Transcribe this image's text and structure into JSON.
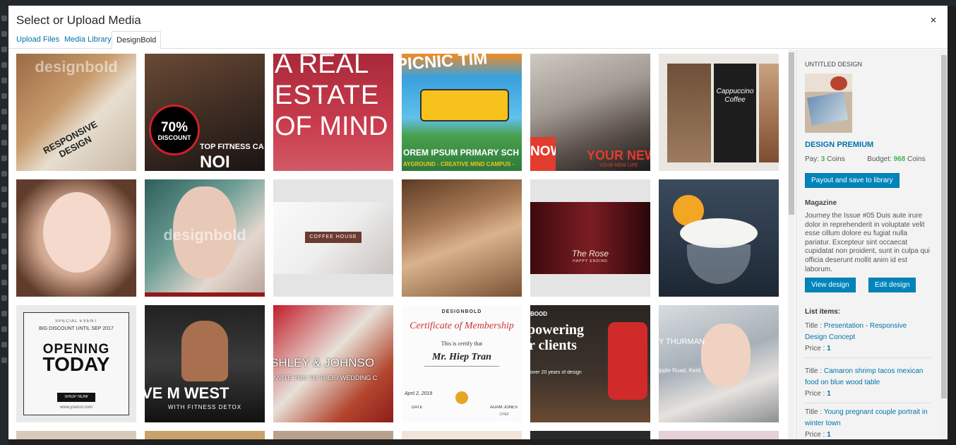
{
  "modal": {
    "title": "Select or Upload Media",
    "close_glyph": "×"
  },
  "tabs": [
    {
      "label": "Upload Files",
      "active": false
    },
    {
      "label": "Media Library",
      "active": false
    },
    {
      "label": "DesignBold",
      "active": true
    }
  ],
  "thumbnails": [
    {
      "caption": "RESPONSIVE DESIGN",
      "watermark": "designbold"
    },
    {
      "badge_value": "70%",
      "badge_label": "DISCOUNT",
      "caption": "TOP FITNESS CA",
      "caption2": "NOI"
    },
    {
      "line1": "A REAL",
      "line2": "ESTATE",
      "line3": "OF MIND"
    },
    {
      "top": "PICNIC TIM",
      "caption": "OREM IPSUM PRIMARY SCH",
      "caption2": "AYGROUND - CREATIVE MIND CAMPUS -"
    },
    {
      "badge": "NOW",
      "caption": "YOUR NEW",
      "caption2": "YOUR NEW LIFE"
    },
    {
      "caption": "Cappuccino Coffee"
    },
    {
      "caption": ""
    },
    {
      "watermark": "designbold"
    },
    {
      "caption": "COFFEE HOUSE"
    },
    {
      "caption": ""
    },
    {
      "caption": "The Rose",
      "caption2": "HAPPY ENDING"
    },
    {
      "caption": ""
    },
    {
      "small": "SPECIAL EVENT",
      "small2": "BIG DISCOUNT UNTIL SEP 2017",
      "line1": "OPENING",
      "line2": "TODAY",
      "button": "SHOP NOW",
      "url": "www.yoururl.com"
    },
    {
      "caption": "VE M WEST",
      "caption2": "WITH FITNESS DETOX"
    },
    {
      "caption": "SHLEY & JOHNSO",
      "caption2": "NVITE YOU TO THEIR WEDDING C"
    },
    {
      "brand": "DESIGNBOLD",
      "title": "Certificate of Membership",
      "line": "This is certify that",
      "name": "Mr. Hiep Tran",
      "date": "April 2, 2019",
      "date_label": "DATE",
      "signer": "ADAM JONES",
      "signer_role": "CHEF"
    },
    {
      "brand": "BOOD",
      "line1": "powering",
      "line2": "r clients",
      "body": "over 20 years of design"
    },
    {
      "caption": "Y THURMAN",
      "caption2": "ipple Road, Kent"
    }
  ],
  "sidebar": {
    "heading": "UNTITLED DESIGN",
    "premium_label": "DESIGN PREMIUM",
    "pay_label": "Pay:",
    "pay_value": "3",
    "pay_unit": "Coins",
    "budget_label": "Budget:",
    "budget_value": "968",
    "budget_unit": "Coins",
    "payout_button": "Payout and save to library",
    "category": "Magazine",
    "description": "Journey the Issue #05 Duis aute irure dolor in reprehenderit in voluptate velit esse cillum dolore eu fugiat nulla pariatur. Excepteur sint occaecat cupidatat non proident, sunt in culpa qui officia deserunt mollit anim id est laborum.",
    "view_button": "View design",
    "edit_button": "Edit design",
    "list_heading": "List items:",
    "items": [
      {
        "title_label": "Title :",
        "title": "Presentation - Responsive Design Concept",
        "price_label": "Price :",
        "price": "1"
      },
      {
        "title_label": "Title :",
        "title": "Camaron shrimp tacos mexican food on blue wood table",
        "price_label": "Price :",
        "price": "1"
      },
      {
        "title_label": "Title :",
        "title": "Young pregnant couple portrait in winter town",
        "price_label": "Price :",
        "price": "1"
      }
    ]
  },
  "colors": {
    "link": "#0073aa",
    "primary_button": "#0085ba",
    "coin_value": "#46b450"
  },
  "icons": [
    "close-icon"
  ]
}
